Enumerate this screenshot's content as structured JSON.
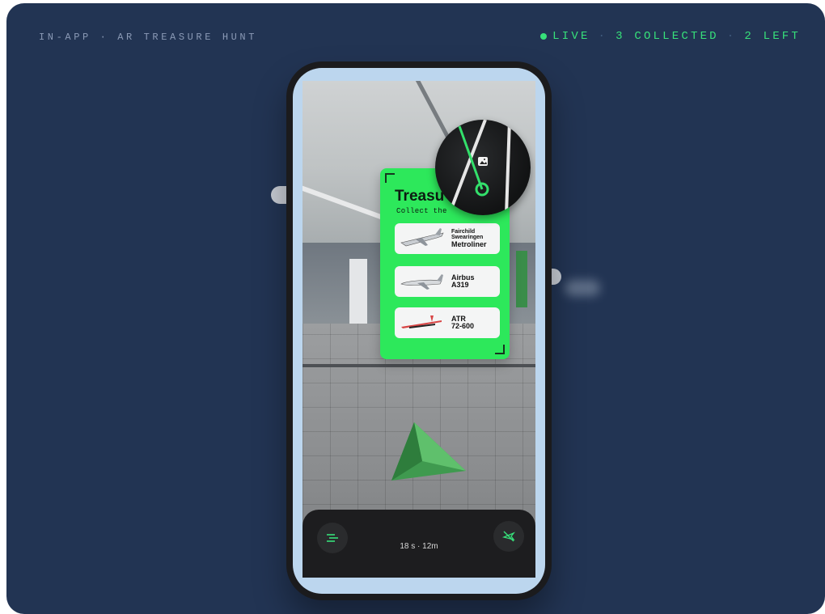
{
  "header": {
    "mode_label": "IN-APP · AR TREASURE HUNT",
    "status_live": "LIVE",
    "status_sep1": "·",
    "status_collected": "3 COLLECTED",
    "status_sep2": "·",
    "status_left": "2 LEFT"
  },
  "colors": {
    "background": "#223453",
    "accent_green": "#37e07a",
    "card_green": "#2de85b",
    "phone_frame": "#1b1b1d"
  },
  "ar_card": {
    "title": "Treasu",
    "subtitle": "Collect the",
    "items": [
      {
        "line1": "Fairchild",
        "line2": "Swearingen",
        "line3": "Metroliner",
        "icon": "plane-thumbnail-icon"
      },
      {
        "line1": "Airbus",
        "line2": "A319",
        "icon": "plane-thumbnail-icon"
      },
      {
        "line1": "ATR",
        "line2": "72-600",
        "icon": "plane-thumbnail-icon"
      }
    ]
  },
  "bottom_bar": {
    "timer_text": "18 s · 12m",
    "left_button_icon": "menu-lines-icon",
    "right_button_icon": "no-plane-icon"
  }
}
